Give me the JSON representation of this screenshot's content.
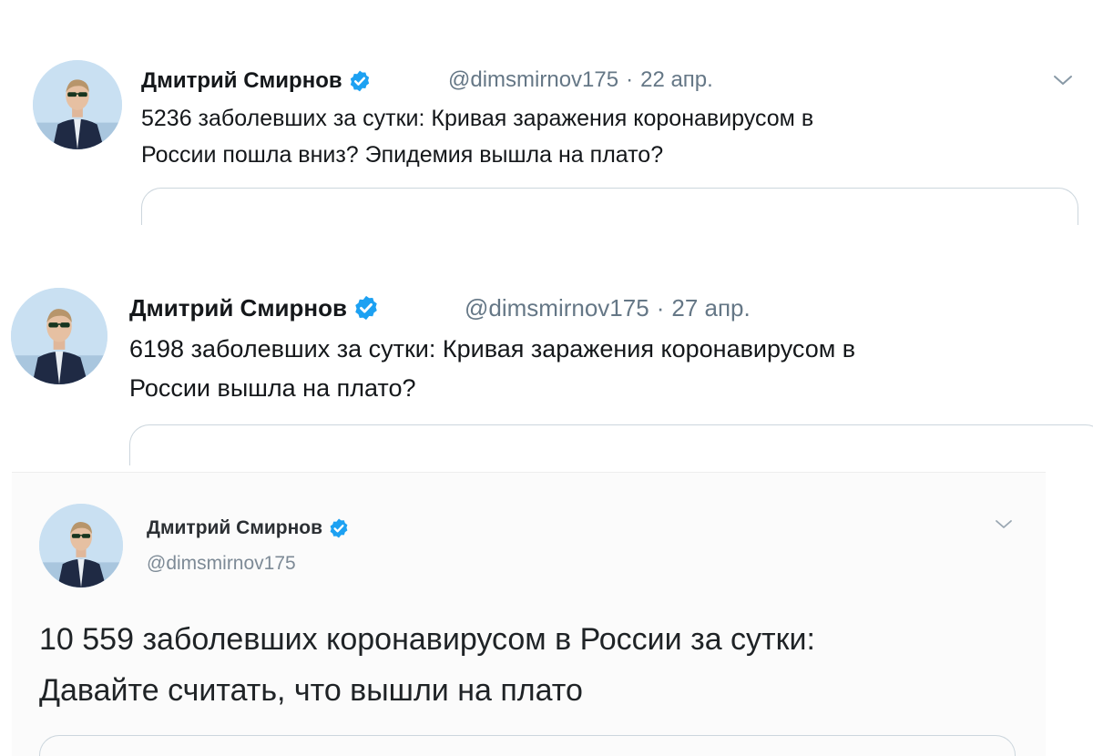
{
  "tweets": [
    {
      "name": "Дмитрий Смирнов",
      "handle": "@dimsmirnov175",
      "separator": "·",
      "date": "22 апр.",
      "line1": "5236 заболевших за сутки: Кривая заражения коронавирусом в",
      "line2": "России пошла вниз? Эпидемия вышла на плато?"
    },
    {
      "name": "Дмитрий Смирнов",
      "handle": "@dimsmirnov175",
      "separator": "·",
      "date": "27 апр.",
      "line1": "6198 заболевших за сутки: Кривая заражения коронавирусом в",
      "line2": "России вышла на плато?"
    },
    {
      "name": "Дмитрий Смирнов",
      "handle": "@dimsmirnov175",
      "line1": "10 559 заболевших коронавирусом в России за сутки:",
      "line2": "Давайте считать, что вышли на плато"
    }
  ],
  "icons": {
    "verified": "verified-badge-icon",
    "more": "chevron-down-icon"
  },
  "colors": {
    "verified": "#1da1f2",
    "text": "#14171a",
    "muted": "#657786",
    "border": "#ccd6dd"
  }
}
